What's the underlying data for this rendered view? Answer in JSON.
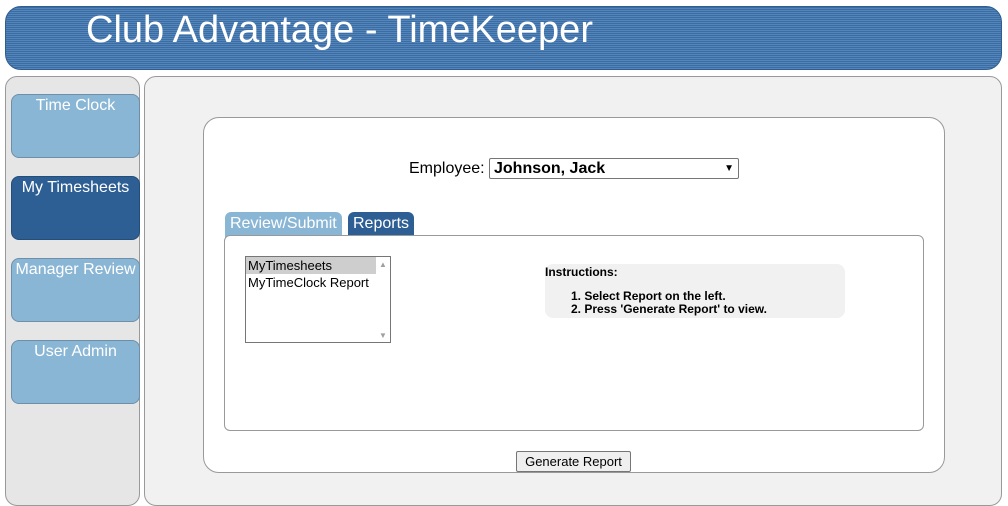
{
  "app": {
    "title": "Club Advantage - TimeKeeper"
  },
  "sidebar": {
    "items": [
      {
        "label": "Time Clock",
        "active": false
      },
      {
        "label": "My Timesheets",
        "active": true
      },
      {
        "label": "Manager Review",
        "active": false
      },
      {
        "label": "User Admin",
        "active": false
      }
    ]
  },
  "employee": {
    "label": "Employee:",
    "selected": "Johnson, Jack"
  },
  "tabs": [
    {
      "label": "Review/Submit",
      "active": false
    },
    {
      "label": "Reports",
      "active": true
    }
  ],
  "reports": {
    "options": [
      "MyTimesheets",
      "MyTimeClock Report"
    ],
    "selected": "MyTimesheets"
  },
  "instructions": {
    "title": "Instructions:",
    "steps": [
      "1. Select Report on the left.",
      "2. Press 'Generate Report' to view."
    ]
  },
  "actions": {
    "generate_label": "Generate Report"
  },
  "colors": {
    "header_blue": "#3b6da5",
    "nav_light": "#8ab6d6",
    "nav_active": "#2d5f94"
  }
}
